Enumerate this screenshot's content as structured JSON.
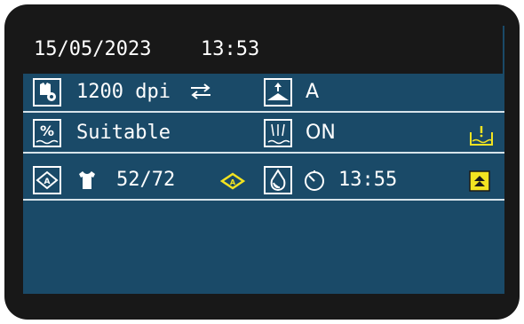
{
  "header": {
    "date": "15/05/2023",
    "time": "13:53"
  },
  "row1": {
    "resolution": "1200 dpi",
    "pass_mode": "A"
  },
  "row2": {
    "media_check": "Suitable",
    "heater": "ON"
  },
  "row3": {
    "count": "52/72",
    "finish_time": "13:55"
  },
  "icons": {
    "resolution": "tshirt-gear-icon",
    "bidirectional": "swap-arrows-icon",
    "platen": "platen-up-icon",
    "media_percent": "percent-water-icon",
    "heater": "heater-icon",
    "ink_tank": "ink-tank-warning-icon",
    "ink_level": "ink-drop-icon",
    "shirt": "tshirt-icon",
    "warning_cap": "cap-warning-icon",
    "drop": "drop-icon",
    "timer": "timer-icon",
    "scroll": "scroll-up-icon"
  },
  "colors": {
    "screen": "#1a4a68",
    "bezel": "#181818",
    "accent_yellow": "#f2e321",
    "text": "#ffffff"
  }
}
